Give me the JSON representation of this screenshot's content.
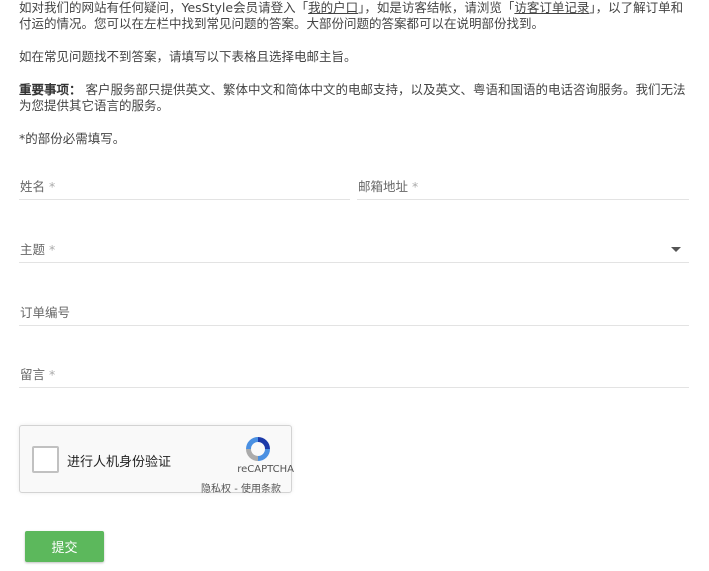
{
  "intro": {
    "p1_a": "如对我们的网站有任何疑问，YesStyle会员请登入「",
    "link_account": "我的户口",
    "p1_b": "」，如是访客结帐，请浏览「",
    "link_guest_orders": "访客订单记录",
    "p1_c": "」，以了解订单和付运的情况。您可以在左栏中找到常见问题的答案。大部份问题的答案都可以在说明部份找到。",
    "p2": "如在常见问题找不到答案，请填写以下表格且选择电邮主旨。",
    "p3_label": "重要事项：",
    "p3_text": " 客户服务部只提供英文、繁体中文和简体中文的电邮支持，以及英文、粤语和国语的电话咨询服务。我们无法为您提供其它语言的服务。",
    "p4": "*的部份必需填写。"
  },
  "form": {
    "name_label": "姓名",
    "email_label": "邮箱地址",
    "subject_label": "主题",
    "order_label": "订单编号",
    "message_label": "留言",
    "required_mark": " *"
  },
  "captcha": {
    "label": "进行人机身份验证",
    "brand": "reCAPTCHA",
    "links": "隐私权 - 使用条款"
  },
  "submit_label": "提交",
  "colors": {
    "submit_bg": "#5cb85c",
    "border": "#e3e3e3"
  }
}
